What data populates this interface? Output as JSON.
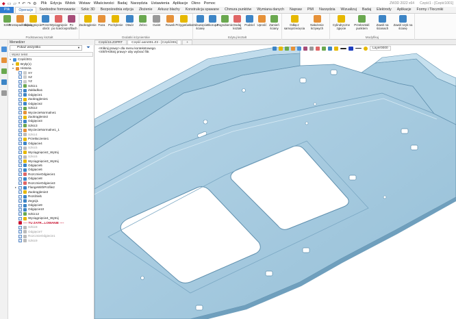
{
  "window": {
    "title_right": "ZW3D 2022 x64",
    "doc_title": "Część1 - [Część1001]"
  },
  "titlebar": {
    "menu": [
      "Plik",
      "Edycja",
      "Widok",
      "Wstaw",
      "Właściwości",
      "Badaj",
      "Narzędzia",
      "Ustawienia",
      "Aplikacje",
      "Okno",
      "Pomoc"
    ]
  },
  "ribbon_tabs": [
    {
      "label": "Plik",
      "kind": "file"
    },
    {
      "label": "Operacje",
      "kind": "active"
    },
    {
      "label": "Swobodne formowanie",
      "kind": ""
    },
    {
      "label": "Szkic 3D",
      "kind": ""
    },
    {
      "label": "Bezpośrednia edycja",
      "kind": ""
    },
    {
      "label": "Złożenie",
      "kind": ""
    },
    {
      "label": "Arkusz blachy",
      "kind": ""
    },
    {
      "label": "Konstrukcja spawane",
      "kind": ""
    },
    {
      "label": "Chmura punktów",
      "kind": ""
    },
    {
      "label": "Wymiana danych",
      "kind": ""
    },
    {
      "label": "Napraw",
      "kind": ""
    },
    {
      "label": "PMI",
      "kind": ""
    },
    {
      "label": "Narzędzia",
      "kind": ""
    },
    {
      "label": "Wizualizuj",
      "kind": ""
    },
    {
      "label": "Badaj",
      "kind": ""
    },
    {
      "label": "Elektrody",
      "kind": ""
    },
    {
      "label": "Aplikacje",
      "kind": ""
    },
    {
      "label": "Formy i Tłoczniki",
      "kind": ""
    }
  ],
  "ribbon_groups": [
    {
      "label": "Podstawowy kształt",
      "width": 116,
      "buttons": [
        {
          "label": "Szkic",
          "color": "#6aa84f"
        },
        {
          "label": "Prostopadłościan",
          "color": "#e69138"
        },
        {
          "label": "Wyciągnięcie",
          "color": "#e6b800"
        },
        {
          "label": "Przez obrót",
          "color": "#3d85c6"
        },
        {
          "label": "Wyciągnięcie po ścieżce",
          "color": "#e06666"
        },
        {
          "label": "Po profilach",
          "color": "#a64d79"
        }
      ]
    },
    {
      "label": "Dodatki inżynierskie",
      "width": 166,
      "buttons": [
        {
          "label": "Zaokrąglenie",
          "color": "#e6b800"
        },
        {
          "label": "Faza",
          "color": "#e69138"
        },
        {
          "label": "Pochylenie",
          "color": "#e6b800"
        },
        {
          "label": "Otwór",
          "color": "#3d85c6"
        },
        {
          "label": "Żebro",
          "color": "#6aa84f"
        },
        {
          "label": "Gwint",
          "color": "#999999"
        },
        {
          "label": "Rowek",
          "color": "#e69138"
        },
        {
          "label": "Przygotówka",
          "color": "#e6b800"
        }
      ]
    },
    {
      "label": "Edytuj kształt",
      "width": 130,
      "buttons": [
        {
          "label": "Odsunięcie ścianę",
          "color": "#3d85c6"
        },
        {
          "label": "Skorupa",
          "color": "#3d85c6"
        },
        {
          "label": "Pogrubienie",
          "color": "#6aa84f"
        },
        {
          "label": "Dodaj kształt",
          "color": "#e06666"
        },
        {
          "label": "Podziel",
          "color": "#3d85c6"
        },
        {
          "label": "Uprość",
          "color": "#e69138"
        },
        {
          "label": "Zamień ściany",
          "color": "#6aa84f"
        }
      ]
    },
    {
      "label": "",
      "width": 70,
      "buttons": [
        {
          "label": "Odłącz samoprzecięcia",
          "color": "#e6b800"
        },
        {
          "label": "Nałożenie krzywych",
          "color": "#e69138"
        }
      ]
    },
    {
      "label": "Modyfikuj",
      "width": 124,
      "buttons": [
        {
          "label": "Cylindryczne zgięcie",
          "color": "#e6b800"
        },
        {
          "label": "Przekształć punktem",
          "color": "#6aa84f"
        },
        {
          "label": "Zawiń na ścianach",
          "color": "#3d85c6"
        },
        {
          "label": "Zawiń szyk na ścianę",
          "color": "#3d85c6"
        }
      ]
    }
  ],
  "manager": {
    "title": "Menedżer",
    "filter": "Pokaż wszystko",
    "search_placeholder": "Wpisz tekst",
    "tree": [
      {
        "label": "Część001",
        "indent": 0,
        "exp": "v",
        "cb": false,
        "icon": "#4a90d9",
        "style": ""
      },
      {
        "label": "Bryły(1)",
        "indent": 1,
        "exp": ">",
        "cb": false,
        "icon": "#e6b800",
        "style": ""
      },
      {
        "label": "Historia",
        "indent": 1,
        "exp": "v",
        "cb": false,
        "icon": "#e69138",
        "style": ""
      },
      {
        "label": "XY",
        "indent": 2,
        "exp": "",
        "cb": true,
        "icon": "#cccccc",
        "style": ""
      },
      {
        "label": "XZ",
        "indent": 2,
        "exp": "",
        "cb": true,
        "icon": "#cccccc",
        "style": ""
      },
      {
        "label": "YZ",
        "indent": 2,
        "exp": "",
        "cb": true,
        "icon": "#cccccc",
        "style": ""
      },
      {
        "label": "Szkic1",
        "indent": 2,
        "exp": "",
        "cb": true,
        "icon": "#6aa84f",
        "style": ""
      },
      {
        "label": "Zakładka1",
        "indent": 2,
        "exp": "",
        "cb": true,
        "icon": "#3d85c6",
        "style": ""
      },
      {
        "label": "Odgięcie1",
        "indent": 2,
        "exp": "",
        "cb": true,
        "icon": "#3d85c6",
        "style": ""
      },
      {
        "label": "Zaokrąglenie1",
        "indent": 2,
        "exp": "",
        "cb": true,
        "icon": "#e6b800",
        "style": ""
      },
      {
        "label": "Odgięcie2",
        "indent": 2,
        "exp": "",
        "cb": true,
        "icon": "#3d85c6",
        "style": ""
      },
      {
        "label": "Szkic2",
        "indent": 2,
        "exp": "",
        "cb": true,
        "icon": "#6aa84f",
        "style": ""
      },
      {
        "label": "WyciecieNormalne1",
        "indent": 2,
        "exp": "",
        "cb": true,
        "icon": "#e69138",
        "style": ""
      },
      {
        "label": "Zaokrąglenie2",
        "indent": 2,
        "exp": "",
        "cb": true,
        "icon": "#e6b800",
        "style": ""
      },
      {
        "label": "Odgięcie3",
        "indent": 2,
        "exp": "",
        "cb": true,
        "icon": "#3d85c6",
        "style": ""
      },
      {
        "label": "Szkic3",
        "indent": 2,
        "exp": "",
        "cb": true,
        "icon": "#6aa84f",
        "style": ""
      },
      {
        "label": "WyciecieNormalne1_1",
        "indent": 2,
        "exp": "",
        "cb": true,
        "icon": "#e69138",
        "style": ""
      },
      {
        "label": "Szkic4",
        "indent": 2,
        "exp": "",
        "cb": true,
        "icon": "#bbbbbb",
        "style": "grey"
      },
      {
        "label": "Przetłoczenie1",
        "indent": 2,
        "exp": "",
        "cb": true,
        "icon": "#e6b800",
        "style": ""
      },
      {
        "label": "Odgięcie4",
        "indent": 2,
        "exp": "",
        "cb": true,
        "icon": "#3d85c6",
        "style": ""
      },
      {
        "label": "Szkic5",
        "indent": 2,
        "exp": "",
        "cb": true,
        "icon": "#bbbbbb",
        "style": "grey"
      },
      {
        "label": "Wyciągnięcie2_Wytnij",
        "indent": 2,
        "exp": "",
        "cb": true,
        "icon": "#e6b800",
        "style": ""
      },
      {
        "label": "Szkic6",
        "indent": 2,
        "exp": "",
        "cb": true,
        "icon": "#bbbbbb",
        "style": "grey"
      },
      {
        "label": "Wyciągnięcie3_Wytnij",
        "indent": 2,
        "exp": "",
        "cb": true,
        "icon": "#e6b800",
        "style": ""
      },
      {
        "label": "Odgięcie5",
        "indent": 2,
        "exp": "",
        "cb": true,
        "icon": "#3d85c6",
        "style": ""
      },
      {
        "label": "Odgięcie6",
        "indent": 2,
        "exp": "",
        "cb": true,
        "icon": "#3d85c6",
        "style": ""
      },
      {
        "label": "RozcznieOdgiecie1",
        "indent": 2,
        "exp": "",
        "cb": true,
        "icon": "#e06666",
        "style": ""
      },
      {
        "label": "Odgięcie8",
        "indent": 2,
        "exp": "",
        "cb": true,
        "icon": "#3d85c6",
        "style": ""
      },
      {
        "label": "RozcznieOdgiecie3",
        "indent": 2,
        "exp": "",
        "cb": true,
        "icon": "#e06666",
        "style": ""
      },
      {
        "label": "FlangeWithProfile2",
        "indent": 2,
        "exp": ">",
        "cb": true,
        "icon": "#3d85c6",
        "style": ""
      },
      {
        "label": "Zaokrąglenie3",
        "indent": 2,
        "exp": "",
        "cb": true,
        "icon": "#e6b800",
        "style": ""
      },
      {
        "label": "Rozdział1",
        "indent": 2,
        "exp": "",
        "cb": true,
        "icon": "#3d85c6",
        "style": ""
      },
      {
        "label": "Zegnij1",
        "indent": 2,
        "exp": "",
        "cb": true,
        "icon": "#3d85c6",
        "style": ""
      },
      {
        "label": "Odgięcie9",
        "indent": 2,
        "exp": "",
        "cb": true,
        "icon": "#3d85c6",
        "style": ""
      },
      {
        "label": "Odgięcie10",
        "indent": 2,
        "exp": "",
        "cb": true,
        "icon": "#3d85c6",
        "style": ""
      },
      {
        "label": "Szkic12",
        "indent": 2,
        "exp": "",
        "cb": true,
        "icon": "#6aa84f",
        "style": ""
      },
      {
        "label": "Wyciągnięcie4_Wytnij",
        "indent": 2,
        "exp": "",
        "cb": true,
        "icon": "#e6b800",
        "style": ""
      },
      {
        "label": "---- TU ZATR...LOWANIE ----",
        "indent": 2,
        "exp": "",
        "cb": false,
        "icon": "#c8102e",
        "style": "red"
      },
      {
        "label": "Szkic8",
        "indent": 2,
        "exp": "",
        "cb": true,
        "icon": "#bbbbbb",
        "style": "grey"
      },
      {
        "label": "Odgięcie7",
        "indent": 2,
        "exp": "",
        "cb": true,
        "icon": "#bbbbbb",
        "style": "grey"
      },
      {
        "label": "RozcznieOdgiecie1",
        "indent": 2,
        "exp": "",
        "cb": true,
        "icon": "#bbbbbb",
        "style": "grey"
      },
      {
        "label": "Szkic9",
        "indent": 2,
        "exp": "",
        "cb": true,
        "icon": "#bbbbbb",
        "style": "grey"
      }
    ]
  },
  "doc_tabs": [
    {
      "label": "Część15.Z3PRT",
      "active": false
    },
    {
      "label": "Część-asm001.Z3 - [Część001]",
      "active": true
    },
    {
      "label": "+",
      "active": false
    }
  ],
  "viewport": {
    "hint1": "<Kliknij prawy> dla menu kontekstowego.",
    "hint2": "<Shift-Kliknij prawy> aby wybrać filtr.",
    "layer": "Layer0000"
  },
  "colors": {
    "accent": "#2f7bd4",
    "sheet_top": "#a8cce0",
    "sheet_edge": "#6f9fbd",
    "sheet_shadow": "#87b2cc"
  }
}
